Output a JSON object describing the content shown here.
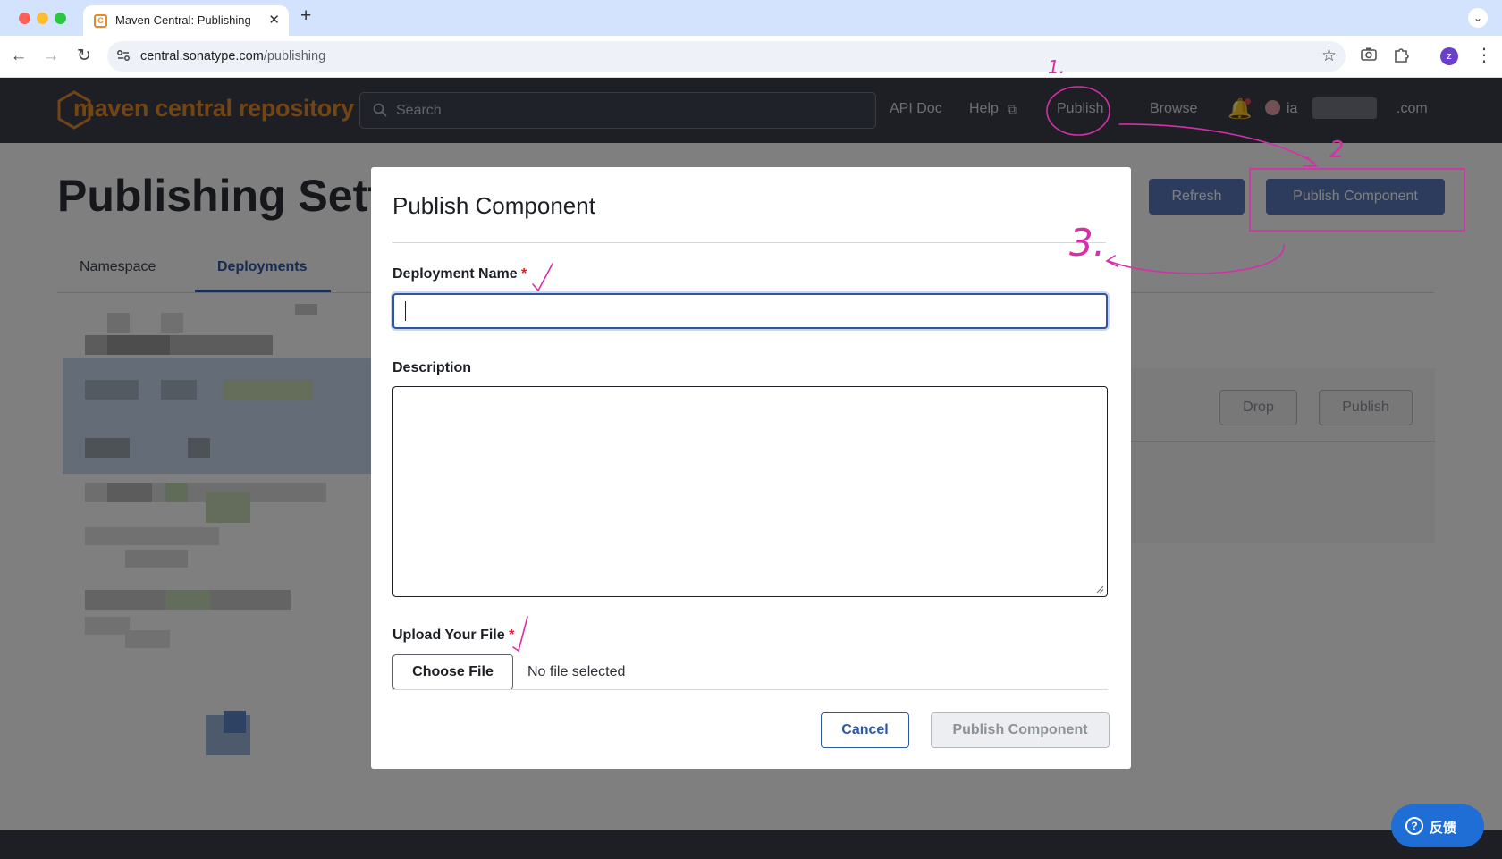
{
  "browser": {
    "tab_title": "Maven Central: Publishing",
    "tab_close": "✕",
    "new_tab": "+",
    "tab_menu": "⌄",
    "url_host": "central.sonatype.com",
    "url_path": "/publishing",
    "profile_initial": "z"
  },
  "header": {
    "logo_text": "maven central repository",
    "search_placeholder": "Search",
    "nav": {
      "api_doc": "API Doc",
      "help": "Help",
      "help_external_glyph": "⧉",
      "publish": "Publish",
      "browse": "Browse"
    },
    "user_fragment": "ia",
    "user_domain": ".com"
  },
  "page": {
    "title": "Publishing Sett",
    "refresh_label": "Refresh",
    "publish_component_label": "Publish Component",
    "tabs": [
      {
        "label": "Namespace",
        "active": false
      },
      {
        "label": "Deployments",
        "active": true
      }
    ],
    "deployment_actions": {
      "drop_label": "Drop",
      "publish_label": "Publish"
    }
  },
  "modal": {
    "title": "Publish Component",
    "deployment_name": {
      "label": "Deployment Name",
      "required_mark": "*",
      "value": ""
    },
    "description": {
      "label": "Description",
      "value": ""
    },
    "upload": {
      "label": "Upload Your File",
      "required_mark": "*",
      "choose_label": "Choose File",
      "status": "No file selected"
    },
    "cancel_label": "Cancel",
    "submit_label": "Publish Component",
    "submit_disabled": true
  },
  "feedback": {
    "label": "反馈",
    "icon_glyph": "?"
  },
  "annotations": {
    "step_marks": [
      "1.",
      "2",
      "3."
    ],
    "color": "#d62fa8"
  },
  "colors": {
    "header_bg": "#3a3f4b",
    "brand_orange": "#e58a2b",
    "primary_blue": "#2f56a3",
    "required_red": "#d3212c",
    "feedback_blue": "#1e6ed6"
  }
}
